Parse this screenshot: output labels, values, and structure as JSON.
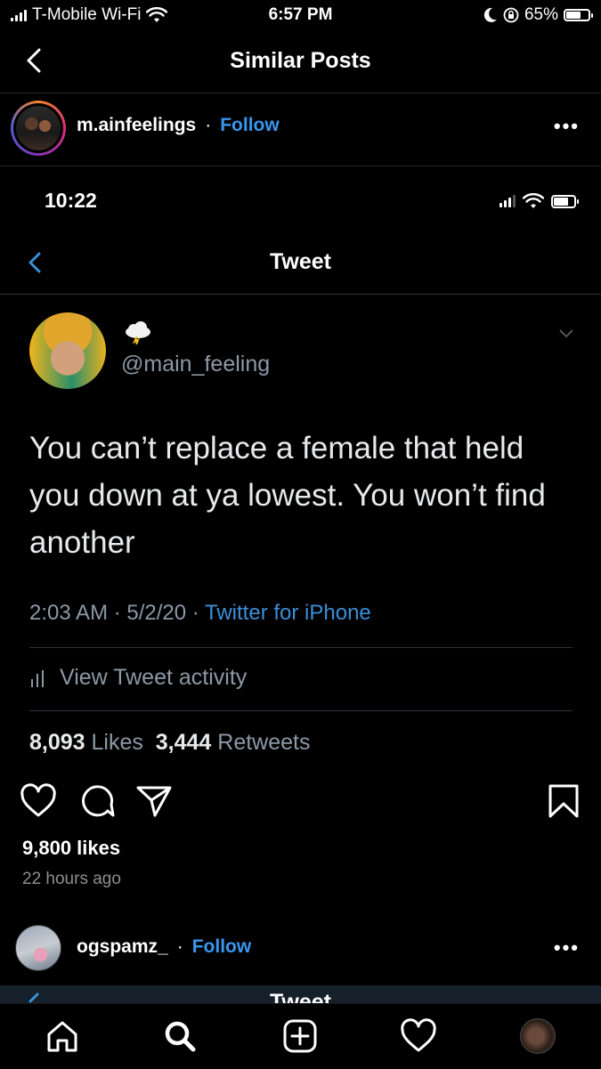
{
  "status_bar": {
    "carrier": "T-Mobile Wi-Fi",
    "time": "6:57 PM",
    "battery": "65%",
    "battery_level": 0.65
  },
  "header": {
    "title": "Similar Posts",
    "back_icon": "chevron-left-icon"
  },
  "post": {
    "username": "m.ainfeelings",
    "separator": "·",
    "follow_label": "Follow",
    "more_label": "•••",
    "screenshot": {
      "time": "10:22",
      "title": "Tweet",
      "handle": "@main_feeling",
      "text": "You can’t replace a female that held you down at ya lowest. You won’t find another",
      "meta_time": "2:03 AM · 5/2/20 · ",
      "meta_source": "Twitter for iPhone",
      "activity_label": "View Tweet activity",
      "likes_count": "8,093",
      "likes_label": " Likes  ",
      "retweets_count": "3,444",
      "retweets_label": " Retweets"
    },
    "likes": "9,800 likes",
    "time_ago": "22 hours ago"
  },
  "next_post": {
    "username": "ogspamz_",
    "separator": "·",
    "follow_label": "Follow",
    "more_label": "•••",
    "peek_title": "Tweet"
  },
  "bottom_nav": {
    "items": [
      "home-icon",
      "search-icon",
      "new-post-icon",
      "activity-heart-icon",
      "profile-avatar"
    ]
  },
  "colors": {
    "background": "#000000",
    "link_blue": "#3897f0",
    "twitter_blue": "#3b8fd8",
    "muted_gray": "#8b98a5"
  }
}
